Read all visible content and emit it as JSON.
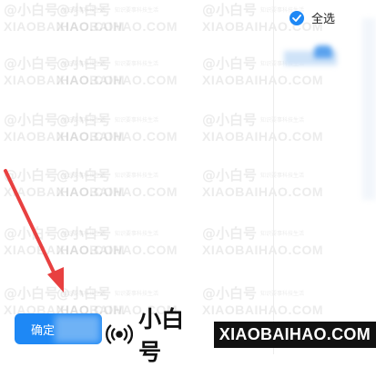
{
  "watermark": {
    "line1": "@小白号",
    "line1_small": "知识要事科技生活",
    "line2": "XIAOBAIHAO.COM"
  },
  "select_all": {
    "label": "全选",
    "checked": true
  },
  "confirm_button": {
    "label": "确定"
  },
  "brand": {
    "name": "小白号",
    "domain": "XIAOBAIHAO.COM"
  },
  "colors": {
    "accent": "#1e88f5",
    "arrow": "#e84040"
  }
}
